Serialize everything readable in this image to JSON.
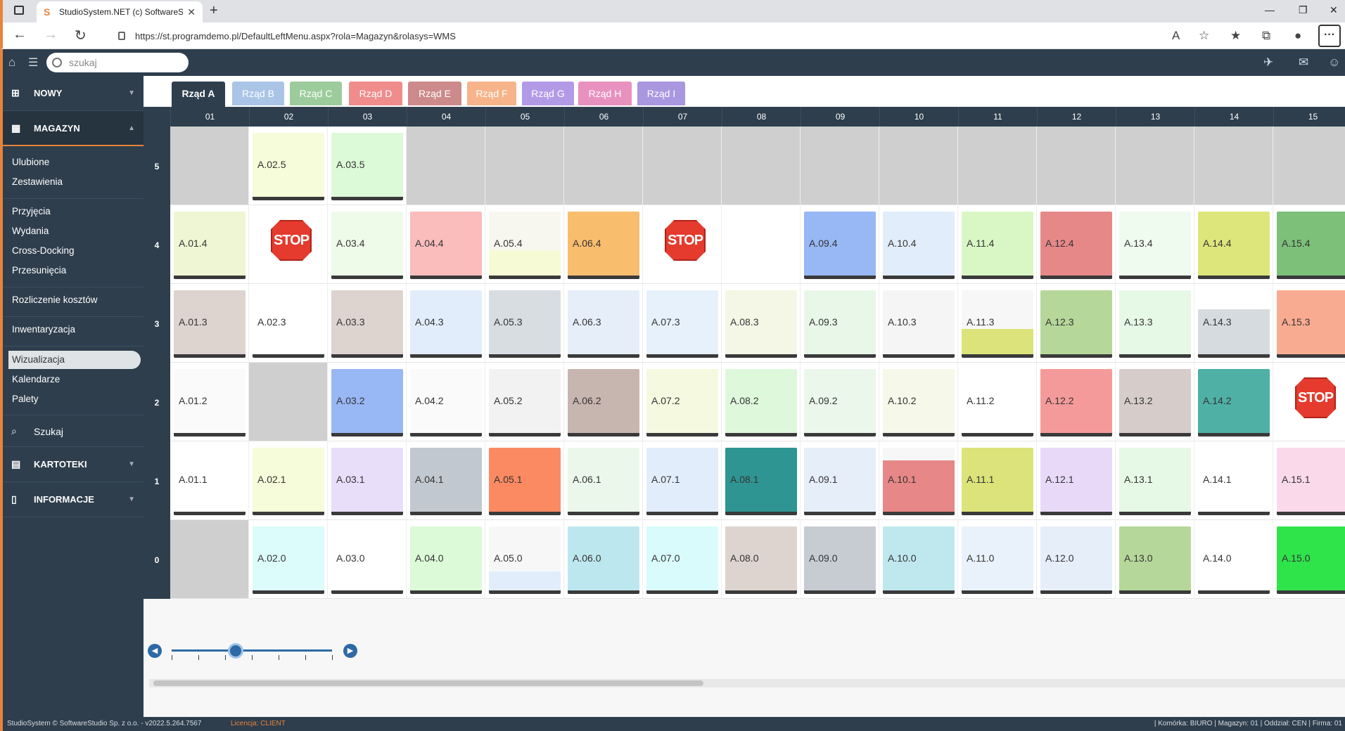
{
  "browser": {
    "tab_title": "StudioSystem.NET (c) SoftwareSt",
    "tab_close": "✕",
    "new_tab": "+",
    "url": "https://st.programdemo.pl/DefaultLeftMenu.aspx?rola=Magazyn&rolasys=WMS",
    "window_minimize": "—",
    "window_restore": "❐",
    "window_close": "✕",
    "more": "···"
  },
  "app": {
    "search_placeholder": "szukaj"
  },
  "sidebar": {
    "nowy": "NOWY",
    "magazyn": "MAGAZYN",
    "kartoteki": "KARTOTEKI",
    "informacje": "INFORMACJE",
    "items": [
      "Ulubione",
      "Zestawienia",
      "Przyjęcia",
      "Wydania",
      "Cross-Docking",
      "Przesunięcia",
      "Rozliczenie kosztów",
      "Inwentaryzacja",
      "Wizualizacja",
      "Kalendarze",
      "Palety"
    ],
    "szukaj": "Szukaj"
  },
  "row_tabs": [
    {
      "label": "Rząd A",
      "color": "#2e3e4d"
    },
    {
      "label": "Rząd B",
      "color": "#a9c4e6"
    },
    {
      "label": "Rząd C",
      "color": "#9ccc9c"
    },
    {
      "label": "Rząd D",
      "color": "#f08c8c"
    },
    {
      "label": "Rząd E",
      "color": "#cd8a8a"
    },
    {
      "label": "Rząd F",
      "color": "#f7b48a"
    },
    {
      "label": "Rząd G",
      "color": "#b39ae6"
    },
    {
      "label": "Rząd H",
      "color": "#e891bf"
    },
    {
      "label": "Rząd I",
      "color": "#a997e0"
    }
  ],
  "columns": [
    "01",
    "02",
    "03",
    "04",
    "05",
    "06",
    "07",
    "08",
    "09",
    "10",
    "11",
    "12",
    "13",
    "14",
    "15"
  ],
  "levels": [
    "5",
    "4",
    "3",
    "2",
    "1",
    "0"
  ],
  "grid": [
    [
      {
        "t": "gray"
      },
      {
        "label": "A.02.5",
        "bg": "#f6fbd9"
      },
      {
        "label": "A.03.5",
        "bg": "#dcf9d8"
      },
      {
        "t": "gray"
      },
      {
        "t": "gray"
      },
      {
        "t": "gray"
      },
      {
        "t": "gray"
      },
      {
        "t": "gray"
      },
      {
        "t": "gray"
      },
      {
        "t": "gray"
      },
      {
        "t": "gray"
      },
      {
        "t": "gray"
      },
      {
        "t": "gray"
      },
      {
        "t": "gray"
      },
      {
        "t": "gray"
      }
    ],
    [
      {
        "label": "A.01.4",
        "bg": "#eef6d3"
      },
      {
        "t": "stop"
      },
      {
        "label": "A.03.4",
        "bg": "#eefbe9"
      },
      {
        "label": "A.04.4",
        "bg": "#fbbcbc"
      },
      {
        "label": "A.05.4",
        "bg": "#f7f7ef",
        "fill": "#f6fbd6",
        "fill_pct": 40
      },
      {
        "label": "A.06.4",
        "bg": "#f9bd6e"
      },
      {
        "t": "stop"
      },
      {
        "t": "empty"
      },
      {
        "label": "A.09.4",
        "bg": "#98b7f5"
      },
      {
        "label": "A.10.4",
        "bg": "#e1edfb"
      },
      {
        "label": "A.11.4",
        "bg": "#d9f7c4"
      },
      {
        "label": "A.12.4",
        "bg": "#e68888"
      },
      {
        "label": "A.13.4",
        "bg": "#eefbee"
      },
      {
        "label": "A.14.4",
        "bg": "#dde67a"
      },
      {
        "label": "A.15.4",
        "bg": "#7cc07a"
      }
    ],
    [
      {
        "label": "A.01.3",
        "bg": "#ddd3cf"
      },
      {
        "label": "A.02.3",
        "bg": "#ffffff"
      },
      {
        "label": "A.03.3",
        "bg": "#ddd3cf"
      },
      {
        "label": "A.04.3",
        "bg": "#e2edfb"
      },
      {
        "label": "A.05.3",
        "bg": "#d8dde2"
      },
      {
        "label": "A.06.3",
        "bg": "#e6eefa"
      },
      {
        "label": "A.07.3",
        "bg": "#e6f1fc"
      },
      {
        "label": "A.08.3",
        "bg": "#f5f7e6"
      },
      {
        "label": "A.09.3",
        "bg": "#e9f7e8"
      },
      {
        "label": "A.10.3",
        "bg": "#f5f5f5"
      },
      {
        "label": "A.11.3",
        "bg": "#f7f7f7",
        "fill": "#dbe37a",
        "fill_pct": 40
      },
      {
        "label": "A.12.3",
        "bg": "#b6d79a"
      },
      {
        "label": "A.13.3",
        "bg": "#e6f9e6"
      },
      {
        "label": "A.14.3",
        "bg": "#ffffff",
        "fill": "#d6dbe0",
        "fill_pct": 70
      },
      {
        "label": "A.15.3",
        "bg": "#f9ab92"
      }
    ],
    [
      {
        "label": "A.01.2",
        "bg": "#fafafa"
      },
      {
        "t": "gray"
      },
      {
        "label": "A.03.2",
        "bg": "#98b7f5"
      },
      {
        "label": "A.04.2",
        "bg": "#fafafa"
      },
      {
        "label": "A.05.2",
        "bg": "#f2f2f2"
      },
      {
        "label": "A.06.2",
        "bg": "#c7b6b0"
      },
      {
        "label": "A.07.2",
        "bg": "#f5f9e0"
      },
      {
        "label": "A.08.2",
        "bg": "#def8dc"
      },
      {
        "label": "A.09.2",
        "bg": "#eaf7ea"
      },
      {
        "label": "A.10.2",
        "bg": "#f6f8ea"
      },
      {
        "label": "A.11.2",
        "bg": "#ffffff"
      },
      {
        "label": "A.12.2",
        "bg": "#f59a9a"
      },
      {
        "label": "A.13.2",
        "bg": "#d6cdca"
      },
      {
        "label": "A.14.2",
        "bg": "#4fb0a6"
      },
      {
        "t": "stop"
      }
    ],
    [
      {
        "label": "A.01.1",
        "bg": "#ffffff"
      },
      {
        "label": "A.02.1",
        "bg": "#f6fbd9"
      },
      {
        "label": "A.03.1",
        "bg": "#e8defa"
      },
      {
        "label": "A.04.1",
        "bg": "#c2c8cf"
      },
      {
        "label": "A.05.1",
        "bg": "#fb8a62"
      },
      {
        "label": "A.06.1",
        "bg": "#eaf7ea"
      },
      {
        "label": "A.07.1",
        "bg": "#e2edfb"
      },
      {
        "label": "A.08.1",
        "bg": "#2e9592"
      },
      {
        "label": "A.09.1",
        "bg": "#e6eefa"
      },
      {
        "label": "A.10.1",
        "bg": "#f7f7f7",
        "fill": "#e88787",
        "fill_pct": 80
      },
      {
        "label": "A.11.1",
        "bg": "#dbe37a"
      },
      {
        "label": "A.12.1",
        "bg": "#e8d9f9"
      },
      {
        "label": "A.13.1",
        "bg": "#e6f9e6"
      },
      {
        "label": "A.14.1",
        "bg": "#ffffff"
      },
      {
        "label": "A.15.1",
        "bg": "#fad9ea"
      }
    ],
    [
      {
        "t": "gray"
      },
      {
        "label": "A.02.0",
        "bg": "#dcfbfb"
      },
      {
        "label": "A.03.0",
        "bg": "#ffffff"
      },
      {
        "label": "A.04.0",
        "bg": "#dcf9d8"
      },
      {
        "label": "A.05.0",
        "bg": "#f7f7f7",
        "fill": "#e2edfb",
        "fill_pct": 30
      },
      {
        "label": "A.06.0",
        "bg": "#bde7ee"
      },
      {
        "label": "A.07.0",
        "bg": "#d9fbfb"
      },
      {
        "label": "A.08.0",
        "bg": "#ddd3cf"
      },
      {
        "label": "A.09.0",
        "bg": "#c7ccd2"
      },
      {
        "label": "A.10.0",
        "bg": "#bfe8ee"
      },
      {
        "label": "A.11.0",
        "bg": "#e9f2fb"
      },
      {
        "label": "A.12.0",
        "bg": "#e6eefa"
      },
      {
        "label": "A.13.0",
        "bg": "#b6d79a"
      },
      {
        "label": "A.14.0",
        "bg": "#ffffff"
      },
      {
        "label": "A.15.0",
        "bg": "#2fe34a"
      }
    ]
  ],
  "stop_text": "STOP",
  "slider": {
    "prev": "◀",
    "next": "▶",
    "position_pct": 40
  },
  "status": {
    "left": "StudioSystem © SoftwareStudio Sp. z o.o. - v2022.5.264.7567",
    "license": "Licencja: CLIENT",
    "right": "| Komórka: BIURO | Magazyn: 01 | Oddział: CEN | Firma: 01"
  }
}
